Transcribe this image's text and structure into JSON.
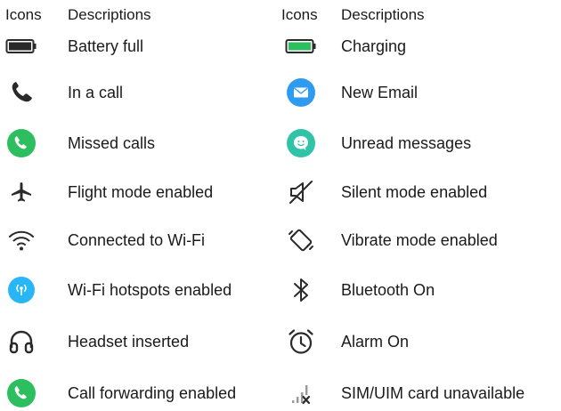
{
  "headers": {
    "left": {
      "icons": "Icons",
      "descriptions": "Descriptions"
    },
    "right": {
      "icons": "Icons",
      "descriptions": "Descriptions"
    }
  },
  "left": [
    {
      "icon": "battery-full-icon",
      "label": "Battery full"
    },
    {
      "icon": "phone-icon",
      "label": "In a call"
    },
    {
      "icon": "missed-call-icon",
      "label": "Missed calls"
    },
    {
      "icon": "airplane-icon",
      "label": "Flight mode enabled"
    },
    {
      "icon": "wifi-icon",
      "label": "Connected to Wi-Fi"
    },
    {
      "icon": "hotspot-icon",
      "label": "Wi-Fi hotspots enabled"
    },
    {
      "icon": "headset-icon",
      "label": "Headset inserted"
    },
    {
      "icon": "call-forwarding-icon",
      "label": "Call forwarding enabled"
    }
  ],
  "right": [
    {
      "icon": "battery-charging-icon",
      "label": "Charging"
    },
    {
      "icon": "email-icon",
      "label": "New Email"
    },
    {
      "icon": "message-icon",
      "label": "Unread messages"
    },
    {
      "icon": "silent-icon",
      "label": "Silent mode enabled"
    },
    {
      "icon": "vibrate-icon",
      "label": "Vibrate mode enabled"
    },
    {
      "icon": "bluetooth-icon",
      "label": "Bluetooth On"
    },
    {
      "icon": "alarm-icon",
      "label": "Alarm On"
    },
    {
      "icon": "sim-unavailable-icon",
      "label": "SIM/UIM card unavailable"
    }
  ],
  "colors": {
    "green": "#2dbe60",
    "blue": "#2e9bf0",
    "teal": "#2fc4a8",
    "cyan": "#29b6f6",
    "dark": "#2a2a2a"
  }
}
